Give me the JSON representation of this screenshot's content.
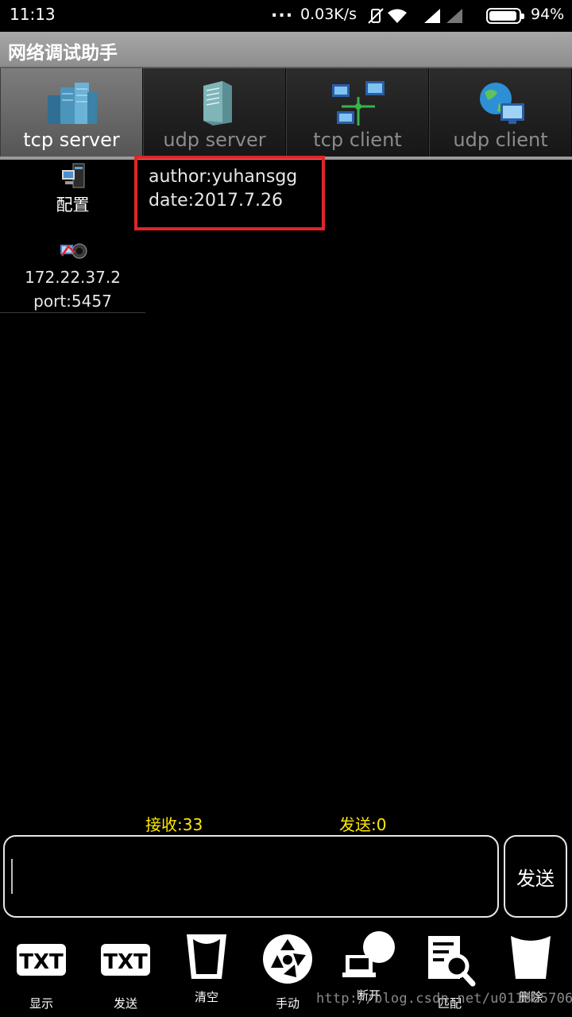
{
  "status_bar": {
    "time": "11:13",
    "dots": "...",
    "speed": "0.03K/s",
    "battery_percent": "94%",
    "battery_level": 0.94
  },
  "app": {
    "title": "网络调试助手"
  },
  "tabs": [
    {
      "label": "tcp server",
      "active": true,
      "icon": "server-cluster-icon"
    },
    {
      "label": "udp server",
      "active": false,
      "icon": "server-tower-icon"
    },
    {
      "label": "tcp client",
      "active": false,
      "icon": "network-computers-icon"
    },
    {
      "label": "udp client",
      "active": false,
      "icon": "globe-computer-icon"
    }
  ],
  "left_panel": {
    "config_label": "配置",
    "ip": "172.22.37.2",
    "port": "port:5457"
  },
  "message": {
    "line1": "author:yuhansgg",
    "line2": "date:2017.7.26"
  },
  "counters": {
    "receive": "接收:33",
    "send": "发送:0"
  },
  "input": {
    "value": "",
    "send_label": "发送"
  },
  "toolbar": [
    {
      "label": "显示",
      "icon": "txt-display-icon"
    },
    {
      "label": "发送",
      "icon": "txt-send-icon"
    },
    {
      "label": "清空",
      "icon": "clear-cup-icon"
    },
    {
      "label": "手动",
      "icon": "aperture-icon"
    },
    {
      "label": "断开",
      "icon": "disconnect-icon"
    },
    {
      "label": "匹配",
      "icon": "document-search-icon"
    },
    {
      "label": "删除",
      "icon": "delete-cup-icon"
    }
  ],
  "watermark": "http://blog.csdn.net/u011385706",
  "colors": {
    "highlight_border": "#e0252b",
    "counter_text": "#ffea00"
  }
}
